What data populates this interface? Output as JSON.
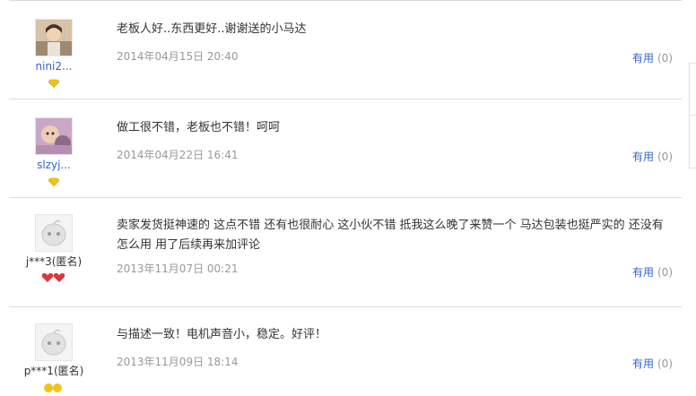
{
  "reviews": [
    {
      "user": "nini2...",
      "text": "老板人好..东西更好..谢谢送的小马达",
      "time": "2014年04月15日 20:40",
      "useful_label": "有用",
      "useful_count": "(0)",
      "anonymous": false
    },
    {
      "user": "slzyj...",
      "text": "做工很不错，老板也不错！呵呵",
      "time": "2014年04月22日 16:41",
      "useful_label": "有用",
      "useful_count": "(0)",
      "anonymous": false
    },
    {
      "user": "j***3(匿名)",
      "text": "卖家发货挺神速的 这点不错 还有也很耐心 这小伙不错 抵我这么晚了来赞一个 马达包装也挺严实的 还没有怎么用 用了后续再来加评论",
      "time": "2013年11月07日 00:21",
      "useful_label": "有用",
      "useful_count": "(0)",
      "anonymous": true
    },
    {
      "user": "p***1(匿名)",
      "text": "与描述一致！电机声音小，稳定。好评！",
      "time": "2013年11月09日 18:14",
      "useful_label": "有用",
      "useful_count": "(0)",
      "anonymous": true
    }
  ],
  "colors": {
    "link": "#3366cc",
    "muted": "#999999",
    "badge_diamond": "#f0c419",
    "badge_heart": "#d9383a"
  }
}
